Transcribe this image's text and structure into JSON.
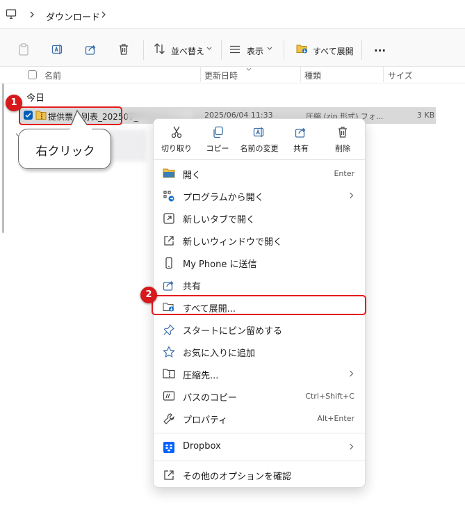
{
  "address": {
    "crumb": "ダウンロード"
  },
  "toolbar": {
    "sort_label": "並べ替え",
    "view_label": "表示",
    "extract_label": "すべて展開",
    "more_label": "..."
  },
  "columns": {
    "name": "名前",
    "date": "更新日時",
    "type": "種類",
    "size": "サイズ"
  },
  "group": {
    "label": "今日"
  },
  "file": {
    "name": "提供票・別表_202507_",
    "date": "2025/06/04 11:33",
    "type": "圧縮 (zip 形式) フォ...",
    "size": "3 KB"
  },
  "annotation": {
    "bubble_text": "右クリック",
    "badge1": "1",
    "badge2": "2"
  },
  "menu": {
    "quick_actions": [
      {
        "label": "切り取り",
        "icon": "scissors-icon"
      },
      {
        "label": "コピー",
        "icon": "copy-icon"
      },
      {
        "label": "名前の変更",
        "icon": "rename-icon"
      },
      {
        "label": "共有",
        "icon": "share-icon"
      },
      {
        "label": "削除",
        "icon": "trash-icon"
      }
    ],
    "items": [
      {
        "label": "開く",
        "shortcut": "Enter",
        "icon": "folder-icon"
      },
      {
        "label": "プログラムから開く",
        "icon": "open-with-icon"
      },
      {
        "label": "新しいタブで開く",
        "icon": "new-tab-icon"
      },
      {
        "label": "新しいウィンドウで開く",
        "icon": "new-window-icon"
      },
      {
        "label": "My Phone に送信",
        "icon": "phone-icon"
      },
      {
        "label": "共有",
        "icon": "share-icon"
      },
      {
        "label": "すべて展開...",
        "icon": "extract-icon"
      },
      {
        "label": "スタートにピン留めする",
        "icon": "pin-icon"
      },
      {
        "label": "お気に入りに追加",
        "icon": "star-icon"
      },
      {
        "label": "圧縮先...",
        "icon": "compress-icon"
      },
      {
        "label": "パスのコピー",
        "shortcut": "Ctrl+Shift+C",
        "icon": "copy-path-icon"
      },
      {
        "label": "プロパティ",
        "shortcut": "Alt+Enter",
        "icon": "wrench-icon"
      },
      {
        "label": "Dropbox",
        "icon": "dropbox-icon"
      },
      {
        "label": "その他のオプションを確認",
        "icon": "more-options-icon"
      }
    ]
  },
  "colors": {
    "accent": "#005fb8",
    "annotation_red": "#e41a1c",
    "selection": "#d9d9d9",
    "dropbox": "#0061fe"
  }
}
